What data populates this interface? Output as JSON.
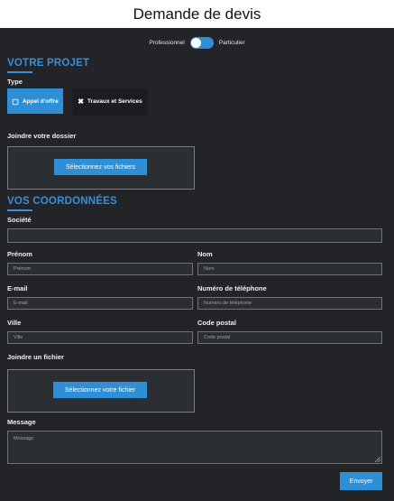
{
  "page": {
    "title": "Demande de devis"
  },
  "toggle": {
    "left_label": "Professionnel",
    "right_label": "Particulier"
  },
  "project": {
    "heading": "VOTRE PROJET",
    "type_label": "Type",
    "type_options": [
      {
        "label": "Appel d'offre",
        "icon": "building-icon",
        "active": true
      },
      {
        "label": "Travaux et Services",
        "icon": "tools-icon",
        "active": false
      }
    ],
    "file_label": "Joindre votre dossier",
    "file_button": "Sélectionnez vos fichiers"
  },
  "contact": {
    "heading": "VOS COORDONNÉES",
    "company_label": "Société",
    "firstname_label": "Prénom",
    "firstname_placeholder": "Prénom",
    "lastname_label": "Nom",
    "lastname_placeholder": "Nom",
    "email_label": "E-mail",
    "email_placeholder": "E-mail",
    "phone_label": "Numéro de téléphone",
    "phone_placeholder": "Numéro de téléphone",
    "city_label": "Ville",
    "city_placeholder": "Ville",
    "zip_label": "Code postal",
    "zip_placeholder": "Code postal",
    "attach_label": "Joindre un fichier",
    "attach_button": "Sélectionnez votre fichier",
    "message_label": "Message",
    "message_placeholder": "Message"
  },
  "submit": {
    "label": "Envoyer"
  },
  "colors": {
    "accent": "#2e8fd6",
    "panel": "#222428",
    "heading": "#3a8fd8"
  }
}
